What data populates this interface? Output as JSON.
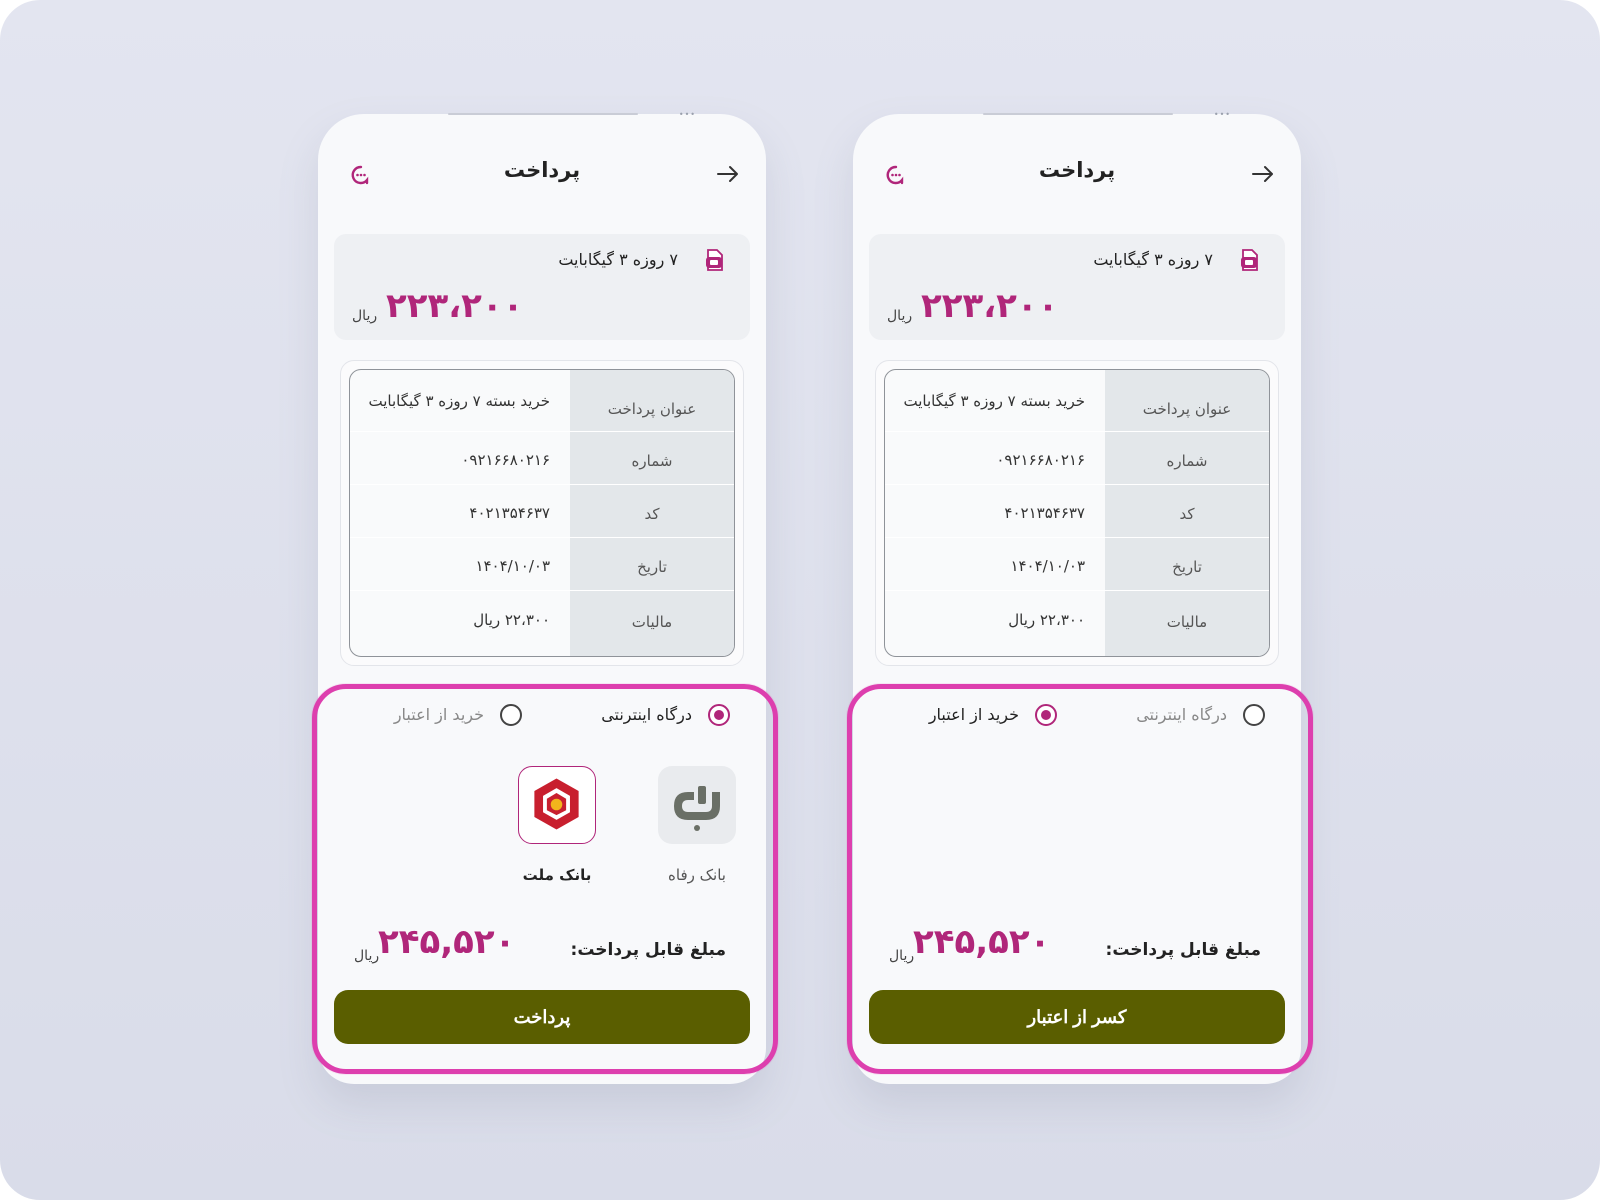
{
  "colors": {
    "accent": "#b0267a",
    "button": "#5a5e00",
    "highlight": "#dd3fae"
  },
  "screens": [
    {
      "header": {
        "title": "پرداخت",
        "back_icon": "arrow-right-icon",
        "support_icon": "support-chat-icon"
      },
      "package": {
        "name": "۷ روزه ۳ گیگابایت",
        "price": "۲۲۳،۲۰۰",
        "unit": "ریال"
      },
      "details": [
        {
          "key": "عنوان پرداخت",
          "value": "خرید بسته ۷ روزه ۳ گیگابایت"
        },
        {
          "key": "شماره",
          "value": "۰۹۲۱۶۶۸۰۲۱۶"
        },
        {
          "key": "کد",
          "value": "۴۰۲۱۳۵۴۶۳۷"
        },
        {
          "key": "تاریخ",
          "value": "۱۴۰۴/۱۰/۰۳"
        },
        {
          "key": "مالیات",
          "value": "۲۲،۳۰۰ ریال"
        }
      ],
      "methods": [
        {
          "label": "درگاه اینترنتی",
          "selected": true
        },
        {
          "label": "خرید از اعتبار",
          "selected": false
        }
      ],
      "banks": [
        {
          "label": "بانک رفاه",
          "selected": false
        },
        {
          "label": "بانک ملت",
          "selected": true
        }
      ],
      "payable": {
        "label": "مبلغ قابل پرداخت:",
        "price": "۲۴۵,۵۲۰",
        "unit": "ریال"
      },
      "button_label": "پرداخت"
    },
    {
      "header": {
        "title": "پرداخت",
        "back_icon": "arrow-right-icon",
        "support_icon": "support-chat-icon"
      },
      "package": {
        "name": "۷ روزه ۳ گیگابایت",
        "price": "۲۲۳،۲۰۰",
        "unit": "ریال"
      },
      "details": [
        {
          "key": "عنوان پرداخت",
          "value": "خرید بسته ۷ روزه ۳ گیگابایت"
        },
        {
          "key": "شماره",
          "value": "۰۹۲۱۶۶۸۰۲۱۶"
        },
        {
          "key": "کد",
          "value": "۴۰۲۱۳۵۴۶۳۷"
        },
        {
          "key": "تاریخ",
          "value": "۱۴۰۴/۱۰/۰۳"
        },
        {
          "key": "مالیات",
          "value": "۲۲،۳۰۰ ریال"
        }
      ],
      "methods": [
        {
          "label": "درگاه اینترنتی",
          "selected": false
        },
        {
          "label": "خرید از اعتبار",
          "selected": true
        }
      ],
      "payable": {
        "label": "مبلغ قابل پرداخت:",
        "price": "۲۴۵,۵۲۰",
        "unit": "ریال"
      },
      "button_label": "کسر از اعتبار"
    }
  ]
}
